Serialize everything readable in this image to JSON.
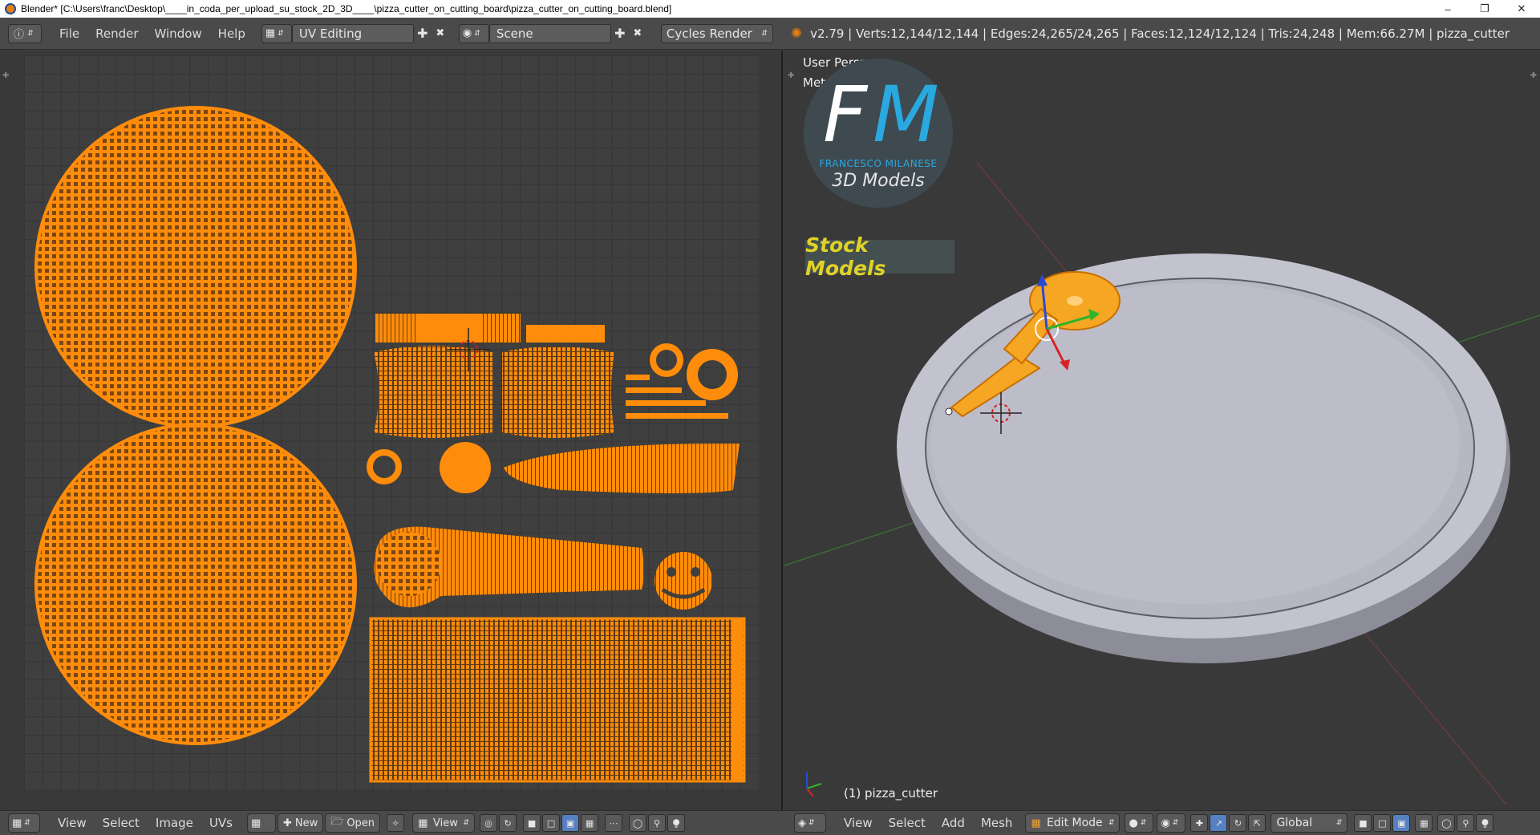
{
  "window": {
    "title": "Blender* [C:\\Users\\franc\\Desktop\\____in_coda_per_upload_su_stock_2D_3D____\\pizza_cutter_on_cutting_board\\pizza_cutter_on_cutting_board.blend]",
    "minimize": "–",
    "restore": "❐",
    "close": "✕"
  },
  "infobar": {
    "menus": [
      "File",
      "Render",
      "Window",
      "Help"
    ],
    "screen_layout": "UV Editing",
    "scene": "Scene",
    "render_engine": "Cycles Render",
    "stats": "v2.79 | Verts:12,144/12,144 | Edges:24,265/24,265 | Faces:12,124/12,124 | Tris:24,248 | Mem:66.27M | pizza_cutter"
  },
  "viewport": {
    "view_name": "User Persp",
    "units": "Meters",
    "object_label": "(1) pizza_cutter"
  },
  "logo": {
    "letters_f": "F",
    "letters_m": "M",
    "name": "FRANCESCO MILANESE",
    "tagline": "3D Models",
    "badge": "Stock Models"
  },
  "uv_footer": {
    "items": [
      "View",
      "Select",
      "Image",
      "UVs"
    ],
    "new": "New",
    "open": "Open",
    "view": "View"
  },
  "view3d_footer": {
    "items": [
      "View",
      "Select",
      "Add",
      "Mesh"
    ],
    "mode": "Edit Mode",
    "orientation": "Global"
  },
  "colors": {
    "uv_orange": "#ff8c0a",
    "selection_orange": "#f5a623",
    "logo_blue": "#2aa8e0",
    "badge_yellow": "#e1d227"
  }
}
